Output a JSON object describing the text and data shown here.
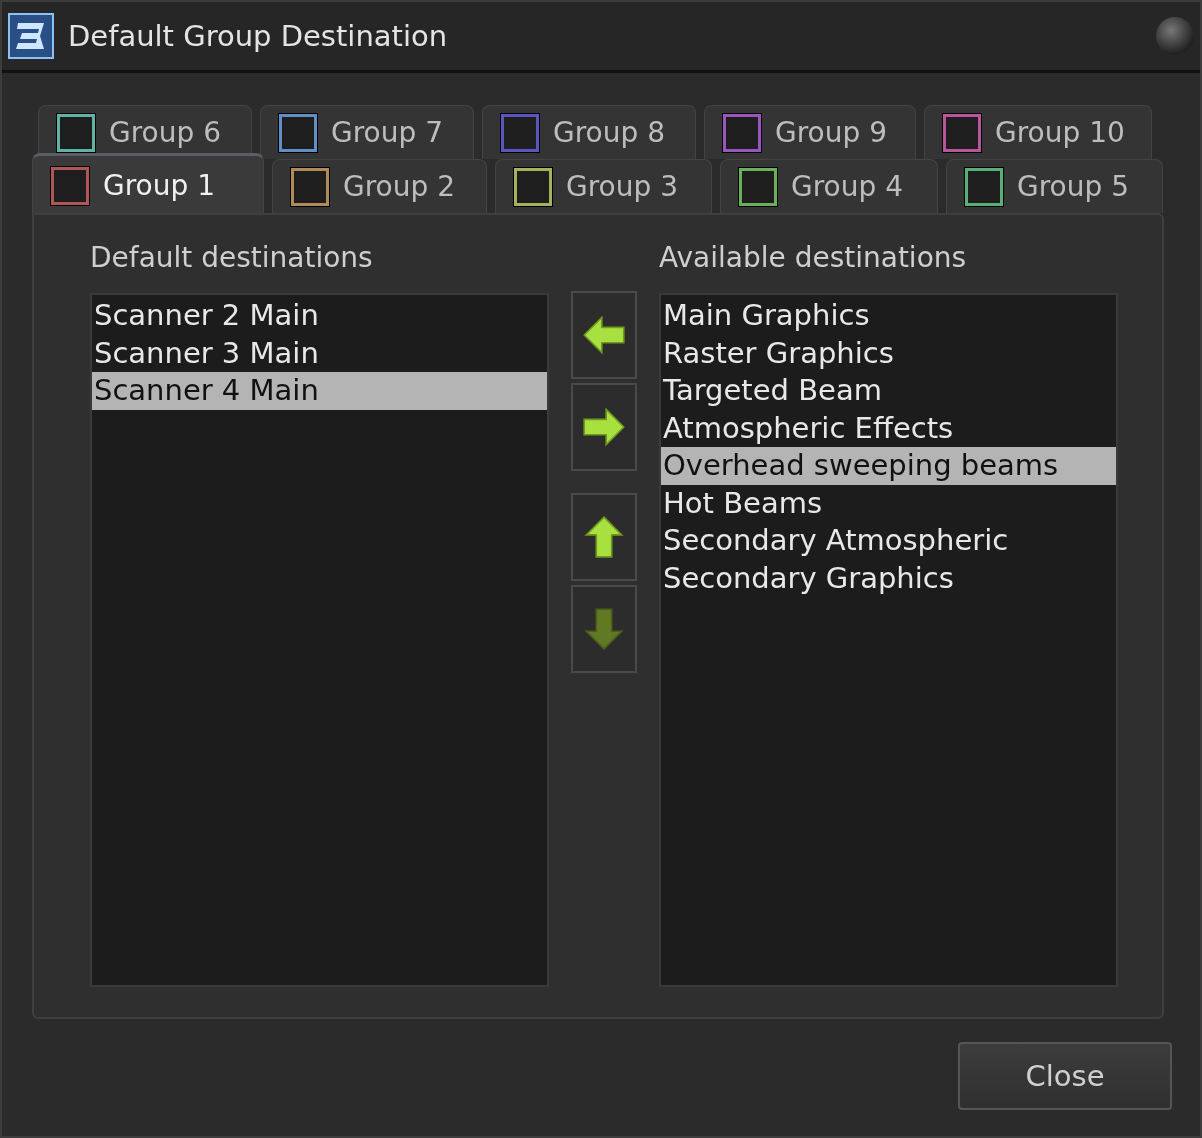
{
  "window": {
    "title": "Default Group Destination"
  },
  "tab_rows": [
    {
      "tabs": [
        {
          "label": "Group 6",
          "color": "#5fb3a4",
          "selected": false
        },
        {
          "label": "Group 7",
          "color": "#5f8fc4",
          "selected": false
        },
        {
          "label": "Group 8",
          "color": "#5a55c0",
          "selected": false
        },
        {
          "label": "Group 9",
          "color": "#9a55c0",
          "selected": false
        },
        {
          "label": "Group 10",
          "color": "#b9559c",
          "selected": false
        }
      ]
    },
    {
      "tabs": [
        {
          "label": "Group 1",
          "color": "#b05656",
          "selected": true
        },
        {
          "label": "Group 2",
          "color": "#b08a58",
          "selected": false
        },
        {
          "label": "Group 3",
          "color": "#a8b058",
          "selected": false
        },
        {
          "label": "Group 4",
          "color": "#6ab058",
          "selected": false
        },
        {
          "label": "Group 5",
          "color": "#58b078",
          "selected": false
        }
      ]
    }
  ],
  "default_destinations": {
    "heading": "Default destinations",
    "items": [
      {
        "label": "Scanner 2 Main",
        "selected": false
      },
      {
        "label": "Scanner 3 Main",
        "selected": false
      },
      {
        "label": "Scanner 4 Main",
        "selected": true
      }
    ]
  },
  "arrow_buttons": [
    {
      "kind": "left",
      "disabled": false
    },
    {
      "kind": "right",
      "disabled": false
    },
    {
      "kind": "up",
      "disabled": false
    },
    {
      "kind": "down",
      "disabled": true
    }
  ],
  "available_destinations": {
    "heading": "Available destinations",
    "items": [
      {
        "label": "Main Graphics",
        "selected": false
      },
      {
        "label": "Raster Graphics",
        "selected": false
      },
      {
        "label": "Targeted Beam",
        "selected": false
      },
      {
        "label": "Atmospheric Effects",
        "selected": false
      },
      {
        "label": "Overhead sweeping beams",
        "selected": true
      },
      {
        "label": "Hot Beams",
        "selected": false
      },
      {
        "label": "Secondary Atmospheric",
        "selected": false
      },
      {
        "label": "Secondary Graphics",
        "selected": false
      }
    ]
  },
  "buttons": [
    {
      "label": "Close"
    }
  ]
}
